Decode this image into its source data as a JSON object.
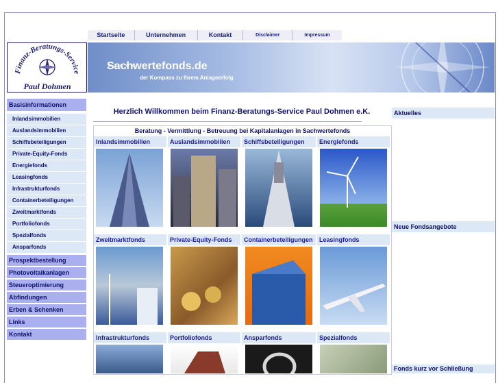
{
  "topnav": [
    "Startseite",
    "Unternehmen",
    "Kontakt",
    "Disclaimer",
    "Impressum"
  ],
  "logo": {
    "arc_text": "Finanz-Beratungs-Service",
    "name": "Paul Dohmen"
  },
  "banner": {
    "title": "Sachwertefonds.de",
    "subtitle": "der Kompass zu Ihrem Anlageerfolg"
  },
  "sidebar": {
    "heading": "Basisinformationen",
    "sub_items": [
      "Inlandsimmobilien",
      "Auslandsimmobilien",
      "Schiffsbeteiligungen",
      "Private-Equity-Fonds",
      "Energiefonds",
      "Leasingfonds",
      "Infrastrukturfonds",
      "Containerbeteiligungen",
      "Zweitmarktfonds",
      "Portfoliofonds",
      "Spezialfonds",
      "Ansparfonds"
    ],
    "main_items": [
      "Prospektbestellung",
      "Photovoltaikanlagen",
      "Steueroptimierung",
      "Abfindungen",
      "Erben & Schenken",
      "Links",
      "Kontakt"
    ]
  },
  "content": {
    "welcome": "Herzlich Willkommen beim Finanz-Beratungs-Service Paul Dohmen e.K.",
    "tagline": "Beratung - Vermittlung - Betreuung bei Kapitalanlagen in Sachwertefonds",
    "categories": [
      "Inlandsimmobilien",
      "Auslandsimmobilien",
      "Schiffsbeteiligungen",
      "Energiefonds",
      "Zweitmarktfonds",
      "Private-Equity-Fonds",
      "Containerbeteiligungen",
      "Leasingfonds",
      "Infrastrukturfonds",
      "Portfoliofonds",
      "Ansparfonds",
      "Spezialfonds"
    ]
  },
  "right": {
    "aktuelles": "Aktuelles",
    "neue": "Neue Fondsangebote",
    "kurz": "Fonds kurz vor Schließung"
  }
}
